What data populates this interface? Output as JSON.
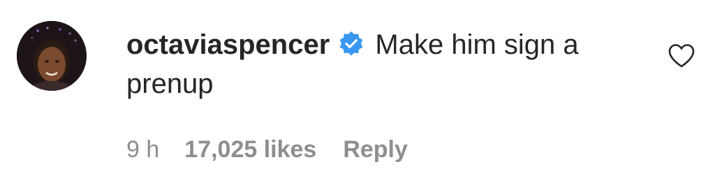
{
  "comment": {
    "username": "octaviaspencer",
    "verified": true,
    "text": "Make him sign a prenup",
    "time": "9 h",
    "likes": "17,025 likes",
    "reply_label": "Reply",
    "like_icon": "heart-outline-icon",
    "verified_icon": "verified-badge-icon"
  },
  "colors": {
    "text": "#262626",
    "meta": "#8e8e8e",
    "verified": "#3897f0",
    "background": "#ffffff"
  }
}
